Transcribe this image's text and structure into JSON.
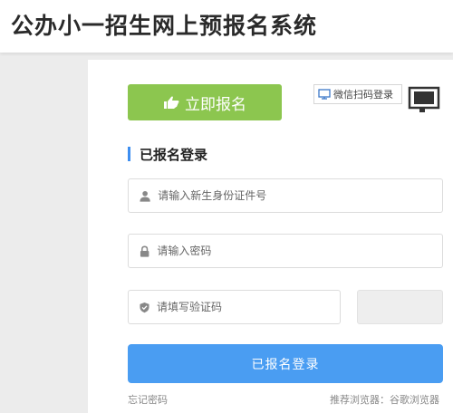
{
  "header": {
    "title": "公办小一招生网上预报名系统"
  },
  "login": {
    "register_button": "立即报名",
    "wechat_login_tab": "微信扫码登录",
    "section_title": "已报名登录",
    "id_placeholder": "请输入新生身份证件号",
    "password_placeholder": "请输入密码",
    "captcha_placeholder": "请填写验证码",
    "submit_button": "已报名登录",
    "forgot_password": "忘记密码",
    "browser_tip": "推荐浏览器：谷歌浏览器"
  },
  "colors": {
    "register_green": "#8cc64f",
    "login_blue": "#4a9df2",
    "accent_bar": "#3d8ef0"
  },
  "icons": {
    "register": "hand-pointer-icon",
    "wechat": "monitor-icon",
    "qr_switch": "monitor-corner-icon",
    "id_field": "user-icon",
    "password_field": "lock-icon",
    "captcha_field": "shield-check-icon"
  }
}
